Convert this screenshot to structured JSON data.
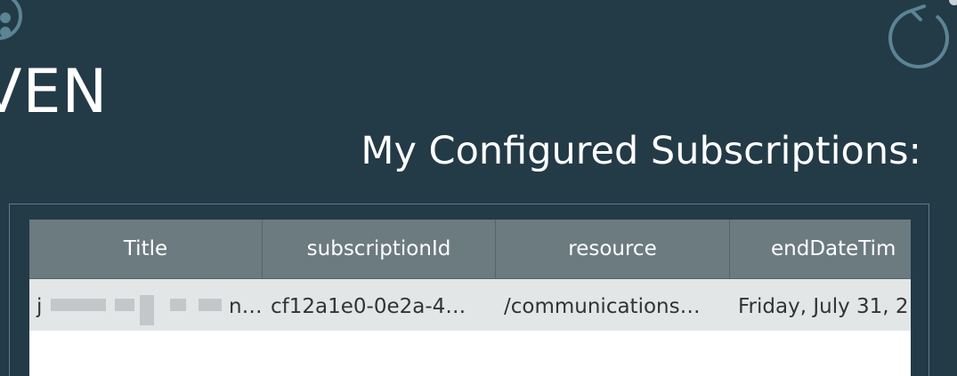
{
  "app": {
    "brand_partial": "VEN"
  },
  "header": {
    "title": "My Configured Subscriptions:"
  },
  "icons": {
    "refresh": "refresh-icon",
    "logo": "logo-mark"
  },
  "colors": {
    "background": "#233a47",
    "header_row": "#6c7b80",
    "data_row": "#e3e6e7",
    "icon_stroke": "#5b8494"
  },
  "table": {
    "columns": [
      "Title",
      "subscriptionId",
      "resource",
      "endDateTim"
    ],
    "rows": [
      {
        "title_visible_start": "j",
        "title_visible_end": "n…",
        "subscriptionId": "cf12a1e0-0e2a-4…",
        "resource": "/communications…",
        "endDateTime": "Friday, July 31, 2"
      }
    ]
  }
}
